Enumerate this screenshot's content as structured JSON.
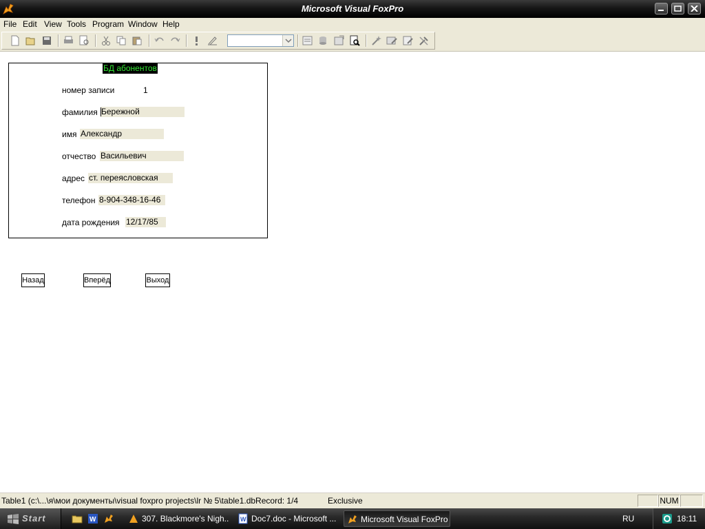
{
  "window": {
    "title": "Microsoft Visual FoxPro"
  },
  "menu": [
    "File",
    "Edit",
    "View",
    "Tools",
    "Program",
    "Window",
    "Help"
  ],
  "toolbar": {
    "combo_value": ""
  },
  "form": {
    "title": "БД абонентов",
    "fields": [
      {
        "label": "номер записи",
        "value": "1"
      },
      {
        "label": "фамилия",
        "value": "Бережной"
      },
      {
        "label": "имя",
        "value": "Александр"
      },
      {
        "label": "отчество",
        "value": "Васильевич"
      },
      {
        "label": "адрес",
        "value": "ст. переясловская"
      },
      {
        "label": "телефон",
        "value": "8-904-348-16-46"
      },
      {
        "label": "дата рождения",
        "value": "12/17/85"
      }
    ],
    "buttons": {
      "back": "Назад",
      "forward": "Вперёд",
      "exit": "Выход"
    }
  },
  "status": {
    "path": "Table1 (c:\\...\\я\\мои документы\\visual foxpro projects\\lr № 5\\table1.dbRecord: 1/4",
    "mode": "Exclusive",
    "num": "NUM"
  },
  "taskbar": {
    "start": "Start",
    "tasks": [
      "307. Blackmore's Nigh...",
      "Doc7.doc - Microsoft ...",
      "Microsoft Visual FoxPro"
    ],
    "lang": "RU",
    "clock": "18:11"
  }
}
